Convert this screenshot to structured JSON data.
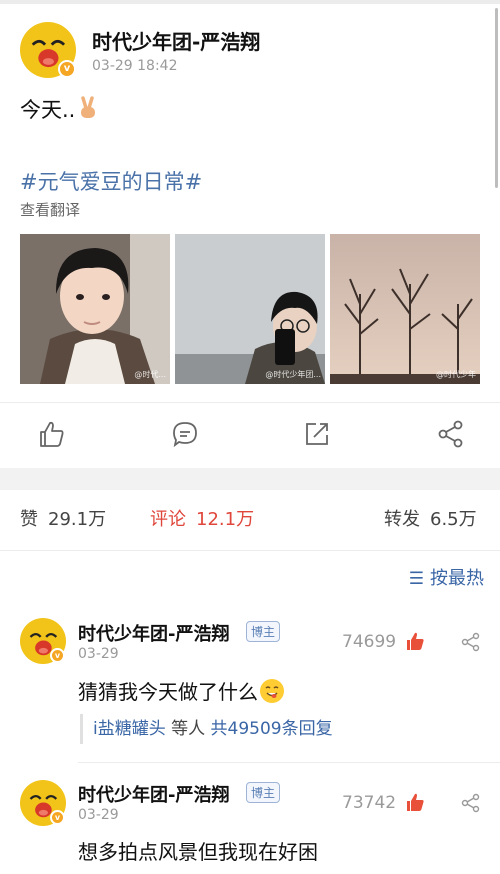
{
  "post": {
    "author": "时代少年团-严浩翔",
    "time": "03-29 18:42",
    "text": "今天..",
    "hashtag": "#元气爱豆的日常#",
    "translate_label": "查看翻译",
    "photos": [
      {
        "watermark": "@时代..."
      },
      {
        "watermark": "@时代少年团..."
      },
      {
        "watermark": "@时代少年"
      }
    ]
  },
  "actions": {
    "like_icon": "thumbs-up-icon",
    "comment_icon": "comment-icon",
    "forward_icon": "forward-icon",
    "share_icon": "share-icon"
  },
  "stats": {
    "like_label": "赞",
    "like_count": "29.1万",
    "comment_label": "评论",
    "comment_count": "12.1万",
    "forward_label": "转发",
    "forward_count": "6.5万"
  },
  "sort": {
    "label": "按最热"
  },
  "comments": [
    {
      "author": "时代少年团-严浩翔",
      "badge": "博主",
      "time": "03-29",
      "likes": "74699",
      "text": "猜猜我今天做了什么",
      "reply_user": "i盐糖罐头",
      "reply_mid": "等人",
      "reply_count": "共49509条回复"
    },
    {
      "author": "时代少年团-严浩翔",
      "badge": "博主",
      "time": "03-29",
      "likes": "73742",
      "text": "想多拍点风景但我现在好困"
    }
  ],
  "colors": {
    "accent_blue": "#4a72a8",
    "accent_red": "#e0473c",
    "avatar_yellow": "#f2c318"
  }
}
